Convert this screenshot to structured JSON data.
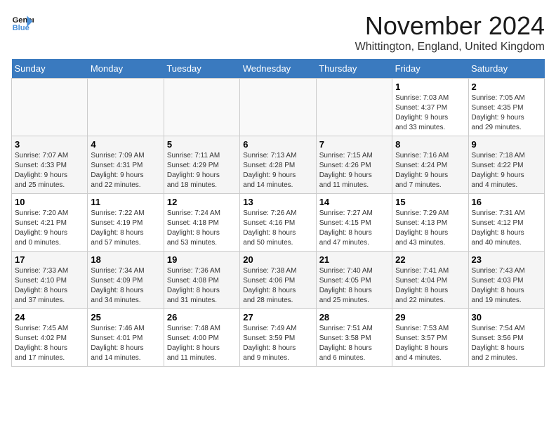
{
  "header": {
    "logo_line1": "General",
    "logo_line2": "Blue",
    "month_title": "November 2024",
    "location": "Whittington, England, United Kingdom"
  },
  "weekdays": [
    "Sunday",
    "Monday",
    "Tuesday",
    "Wednesday",
    "Thursday",
    "Friday",
    "Saturday"
  ],
  "weeks": [
    [
      {
        "day": "",
        "info": ""
      },
      {
        "day": "",
        "info": ""
      },
      {
        "day": "",
        "info": ""
      },
      {
        "day": "",
        "info": ""
      },
      {
        "day": "",
        "info": ""
      },
      {
        "day": "1",
        "info": "Sunrise: 7:03 AM\nSunset: 4:37 PM\nDaylight: 9 hours\nand 33 minutes."
      },
      {
        "day": "2",
        "info": "Sunrise: 7:05 AM\nSunset: 4:35 PM\nDaylight: 9 hours\nand 29 minutes."
      }
    ],
    [
      {
        "day": "3",
        "info": "Sunrise: 7:07 AM\nSunset: 4:33 PM\nDaylight: 9 hours\nand 25 minutes."
      },
      {
        "day": "4",
        "info": "Sunrise: 7:09 AM\nSunset: 4:31 PM\nDaylight: 9 hours\nand 22 minutes."
      },
      {
        "day": "5",
        "info": "Sunrise: 7:11 AM\nSunset: 4:29 PM\nDaylight: 9 hours\nand 18 minutes."
      },
      {
        "day": "6",
        "info": "Sunrise: 7:13 AM\nSunset: 4:28 PM\nDaylight: 9 hours\nand 14 minutes."
      },
      {
        "day": "7",
        "info": "Sunrise: 7:15 AM\nSunset: 4:26 PM\nDaylight: 9 hours\nand 11 minutes."
      },
      {
        "day": "8",
        "info": "Sunrise: 7:16 AM\nSunset: 4:24 PM\nDaylight: 9 hours\nand 7 minutes."
      },
      {
        "day": "9",
        "info": "Sunrise: 7:18 AM\nSunset: 4:22 PM\nDaylight: 9 hours\nand 4 minutes."
      }
    ],
    [
      {
        "day": "10",
        "info": "Sunrise: 7:20 AM\nSunset: 4:21 PM\nDaylight: 9 hours\nand 0 minutes."
      },
      {
        "day": "11",
        "info": "Sunrise: 7:22 AM\nSunset: 4:19 PM\nDaylight: 8 hours\nand 57 minutes."
      },
      {
        "day": "12",
        "info": "Sunrise: 7:24 AM\nSunset: 4:18 PM\nDaylight: 8 hours\nand 53 minutes."
      },
      {
        "day": "13",
        "info": "Sunrise: 7:26 AM\nSunset: 4:16 PM\nDaylight: 8 hours\nand 50 minutes."
      },
      {
        "day": "14",
        "info": "Sunrise: 7:27 AM\nSunset: 4:15 PM\nDaylight: 8 hours\nand 47 minutes."
      },
      {
        "day": "15",
        "info": "Sunrise: 7:29 AM\nSunset: 4:13 PM\nDaylight: 8 hours\nand 43 minutes."
      },
      {
        "day": "16",
        "info": "Sunrise: 7:31 AM\nSunset: 4:12 PM\nDaylight: 8 hours\nand 40 minutes."
      }
    ],
    [
      {
        "day": "17",
        "info": "Sunrise: 7:33 AM\nSunset: 4:10 PM\nDaylight: 8 hours\nand 37 minutes."
      },
      {
        "day": "18",
        "info": "Sunrise: 7:34 AM\nSunset: 4:09 PM\nDaylight: 8 hours\nand 34 minutes."
      },
      {
        "day": "19",
        "info": "Sunrise: 7:36 AM\nSunset: 4:08 PM\nDaylight: 8 hours\nand 31 minutes."
      },
      {
        "day": "20",
        "info": "Sunrise: 7:38 AM\nSunset: 4:06 PM\nDaylight: 8 hours\nand 28 minutes."
      },
      {
        "day": "21",
        "info": "Sunrise: 7:40 AM\nSunset: 4:05 PM\nDaylight: 8 hours\nand 25 minutes."
      },
      {
        "day": "22",
        "info": "Sunrise: 7:41 AM\nSunset: 4:04 PM\nDaylight: 8 hours\nand 22 minutes."
      },
      {
        "day": "23",
        "info": "Sunrise: 7:43 AM\nSunset: 4:03 PM\nDaylight: 8 hours\nand 19 minutes."
      }
    ],
    [
      {
        "day": "24",
        "info": "Sunrise: 7:45 AM\nSunset: 4:02 PM\nDaylight: 8 hours\nand 17 minutes."
      },
      {
        "day": "25",
        "info": "Sunrise: 7:46 AM\nSunset: 4:01 PM\nDaylight: 8 hours\nand 14 minutes."
      },
      {
        "day": "26",
        "info": "Sunrise: 7:48 AM\nSunset: 4:00 PM\nDaylight: 8 hours\nand 11 minutes."
      },
      {
        "day": "27",
        "info": "Sunrise: 7:49 AM\nSunset: 3:59 PM\nDaylight: 8 hours\nand 9 minutes."
      },
      {
        "day": "28",
        "info": "Sunrise: 7:51 AM\nSunset: 3:58 PM\nDaylight: 8 hours\nand 6 minutes."
      },
      {
        "day": "29",
        "info": "Sunrise: 7:53 AM\nSunset: 3:57 PM\nDaylight: 8 hours\nand 4 minutes."
      },
      {
        "day": "30",
        "info": "Sunrise: 7:54 AM\nSunset: 3:56 PM\nDaylight: 8 hours\nand 2 minutes."
      }
    ]
  ]
}
